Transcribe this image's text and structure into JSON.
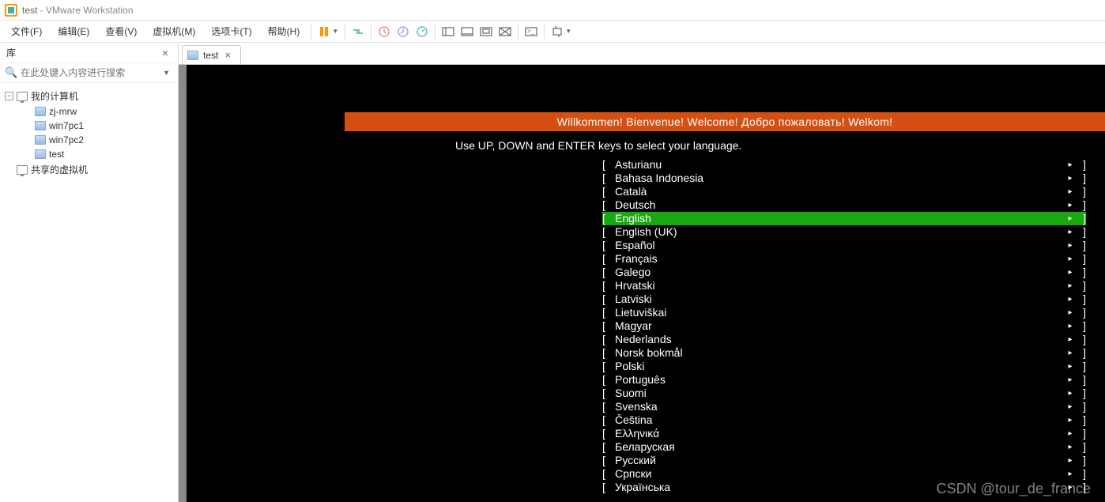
{
  "window": {
    "vm_name": "test",
    "app_name": "VMware Workstation",
    "title_sep": " - "
  },
  "menu": {
    "items": [
      "文件(F)",
      "编辑(E)",
      "查看(V)",
      "虚拟机(M)",
      "选项卡(T)",
      "帮助(H)"
    ]
  },
  "sidebar": {
    "title": "库",
    "search_placeholder": "在此处键入内容进行搜索",
    "root": "我的计算机",
    "vms": [
      "zj-mrw",
      "win7pc1",
      "win7pc2",
      "test"
    ],
    "shared": "共享的虚拟机"
  },
  "tab": {
    "label": "test"
  },
  "console": {
    "banner": "Willkommen! Bienvenue! Welcome! Добро пожаловать! Welkom!",
    "instruction": "Use UP, DOWN and ENTER keys to select your language.",
    "selected_index": 4,
    "languages": [
      "Asturianu",
      "Bahasa Indonesia",
      "Català",
      "Deutsch",
      "English",
      "English (UK)",
      "Español",
      "Français",
      "Galego",
      "Hrvatski",
      "Latviski",
      "Lietuviškai",
      "Magyar",
      "Nederlands",
      "Norsk bokmål",
      "Polski",
      "Português",
      "Suomi",
      "Svenska",
      "Čeština",
      "Ελληνικά",
      "Беларуская",
      "Русский",
      "Српски",
      "Українська"
    ]
  },
  "watermark": "CSDN @tour_de_france"
}
